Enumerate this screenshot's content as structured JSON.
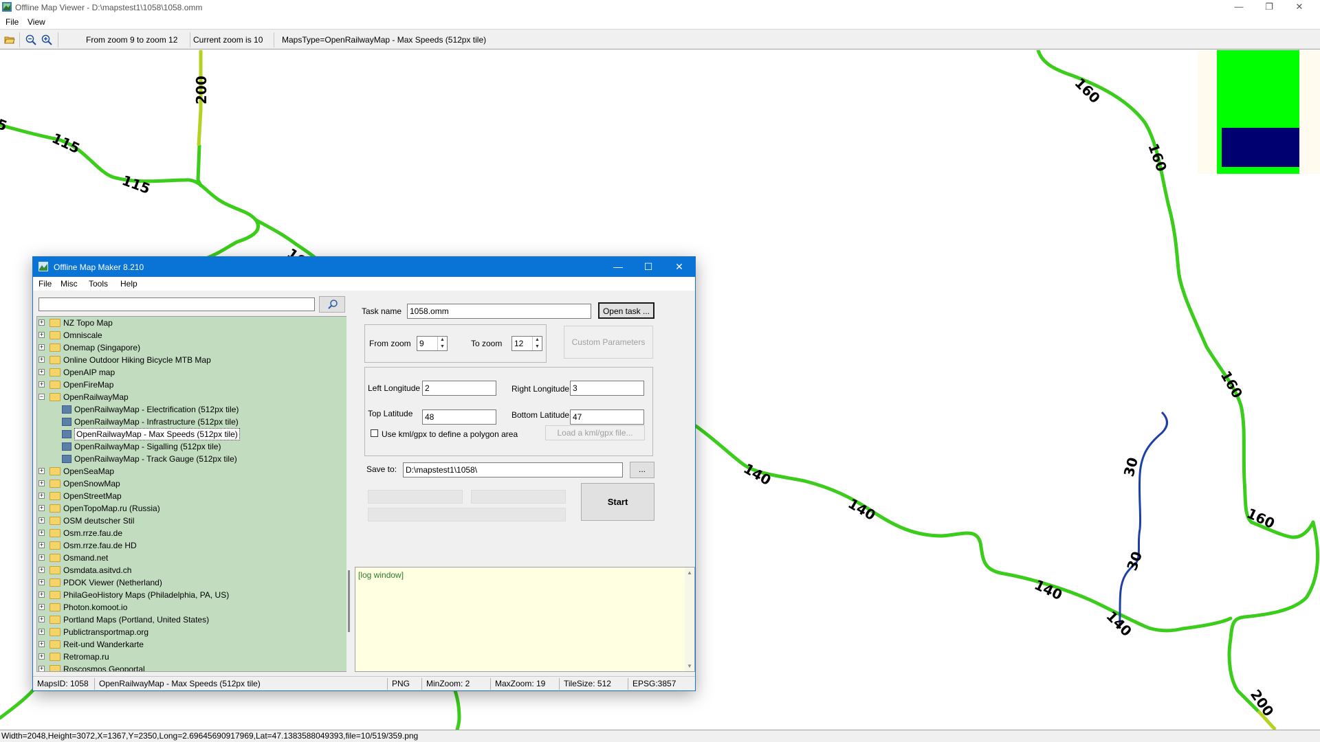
{
  "window": {
    "title": "Offline Map Viewer - D:\\mapstest1\\1058\\1058.omm",
    "menu": [
      "File",
      "View"
    ],
    "controls": {
      "minimize": "—",
      "restore": "❐",
      "close": "✕"
    }
  },
  "toolbar": {
    "zoom_range": "From zoom 9 to zoom 12",
    "current_zoom": "Current zoom is 10",
    "maps_type": "MapsType=OpenRailwayMap - Max Speeds (512px tile)"
  },
  "map": {
    "speed_labels": [
      "200",
      "115",
      "115",
      "160",
      "160",
      "160",
      "160",
      "160",
      "140",
      "140",
      "140",
      "140",
      "30",
      "30",
      "200",
      "5"
    ],
    "colors": {
      "line_green": "#3ccc1c",
      "line_yellowgreen": "#b4d21e",
      "line_blue": "#1f3fa8",
      "minimap_green": "#00ff00",
      "minimap_navy": "#000070"
    }
  },
  "status_bar": "Width=2048,Height=3072,X=1367,Y=2350,Long=2.69645690917969,Lat=47.1383588049393,file=10/519/359.png",
  "dialog": {
    "title": "Offline Map Maker 8.210",
    "menu": [
      "File",
      "Misc",
      "Tools",
      "Help"
    ],
    "search": {
      "value": "",
      "placeholder": ""
    },
    "tree": [
      {
        "label": "NZ Topo Map",
        "type": "folder",
        "expanded": false
      },
      {
        "label": "Omniscale",
        "type": "folder",
        "expanded": false
      },
      {
        "label": "Onemap (Singapore)",
        "type": "folder",
        "expanded": false
      },
      {
        "label": "Online Outdoor Hiking Bicycle MTB Map",
        "type": "folder",
        "expanded": false
      },
      {
        "label": "OpenAIP map",
        "type": "folder",
        "expanded": false
      },
      {
        "label": "OpenFireMap",
        "type": "folder",
        "expanded": false
      },
      {
        "label": "OpenRailwayMap",
        "type": "folder",
        "expanded": true
      },
      {
        "label": "OpenRailwayMap - Electrification (512px tile)",
        "type": "map",
        "child": true
      },
      {
        "label": "OpenRailwayMap - Infrastructure (512px tile)",
        "type": "map",
        "child": true
      },
      {
        "label": "OpenRailwayMap - Max Speeds (512px tile)",
        "type": "map",
        "child": true,
        "selected": true
      },
      {
        "label": "OpenRailwayMap - Sigalling (512px tile)",
        "type": "map",
        "child": true
      },
      {
        "label": "OpenRailwayMap - Track Gauge (512px tile)",
        "type": "map",
        "child": true
      },
      {
        "label": "OpenSeaMap",
        "type": "folder",
        "expanded": false
      },
      {
        "label": "OpenSnowMap",
        "type": "folder",
        "expanded": false
      },
      {
        "label": "OpenStreetMap",
        "type": "folder",
        "expanded": false
      },
      {
        "label": "OpenTopoMap.ru (Russia)",
        "type": "folder",
        "expanded": false
      },
      {
        "label": "OSM deutscher Stil",
        "type": "folder",
        "expanded": false
      },
      {
        "label": "Osm.rrze.fau.de",
        "type": "folder",
        "expanded": false
      },
      {
        "label": "Osm.rrze.fau.de HD",
        "type": "folder",
        "expanded": false
      },
      {
        "label": "Osmand.net",
        "type": "folder",
        "expanded": false
      },
      {
        "label": "Osmdata.asitvd.ch",
        "type": "folder",
        "expanded": false
      },
      {
        "label": "PDOK Viewer (Netherland)",
        "type": "folder",
        "expanded": false
      },
      {
        "label": "PhilaGeoHistory Maps (Philadelphia, PA, US)",
        "type": "folder",
        "expanded": false
      },
      {
        "label": "Photon.komoot.io",
        "type": "folder",
        "expanded": false
      },
      {
        "label": "Portland Maps (Portland, United States)",
        "type": "folder",
        "expanded": false
      },
      {
        "label": "Publictransportmap.org",
        "type": "folder",
        "expanded": false
      },
      {
        "label": "Reit-und Wanderkarte",
        "type": "folder",
        "expanded": false
      },
      {
        "label": "Retromap.ru",
        "type": "folder",
        "expanded": false
      },
      {
        "label": "Roscosmos Geoportal",
        "type": "folder",
        "expanded": false
      }
    ],
    "task": {
      "label": "Task name",
      "value": "1058.omm",
      "open_button": "Open task ..."
    },
    "zoom": {
      "from_label": "From zoom",
      "from_value": "9",
      "to_label": "To zoom",
      "to_value": "12",
      "custom_button": "Custom Parameters"
    },
    "area": {
      "left_lon_label": "Left Longitude",
      "left_lon": "2",
      "right_lon_label": "Right Longitude",
      "right_lon": "3",
      "top_lat_label": "Top Latitude",
      "top_lat": "48",
      "bottom_lat_label": "Bottom Latitude",
      "bottom_lat": "47",
      "kml_checkbox_label": "Use kml/gpx to define a polygon area",
      "kml_checked": false,
      "kml_button": "Load a kml/gpx file..."
    },
    "save": {
      "label": "Save to:",
      "value": "D:\\mapstest1\\1058\\",
      "browse_button": "..."
    },
    "start_button": "Start",
    "log_text": "[log window]",
    "status": {
      "maps_id": "MapsID: 1058",
      "map_name": "OpenRailwayMap - Max Speeds (512px tile)",
      "format": "PNG",
      "min_zoom": "MinZoom: 2",
      "max_zoom": "MaxZoom: 19",
      "tile_size": "TileSize: 512",
      "epsg": "EPSG:3857"
    }
  }
}
